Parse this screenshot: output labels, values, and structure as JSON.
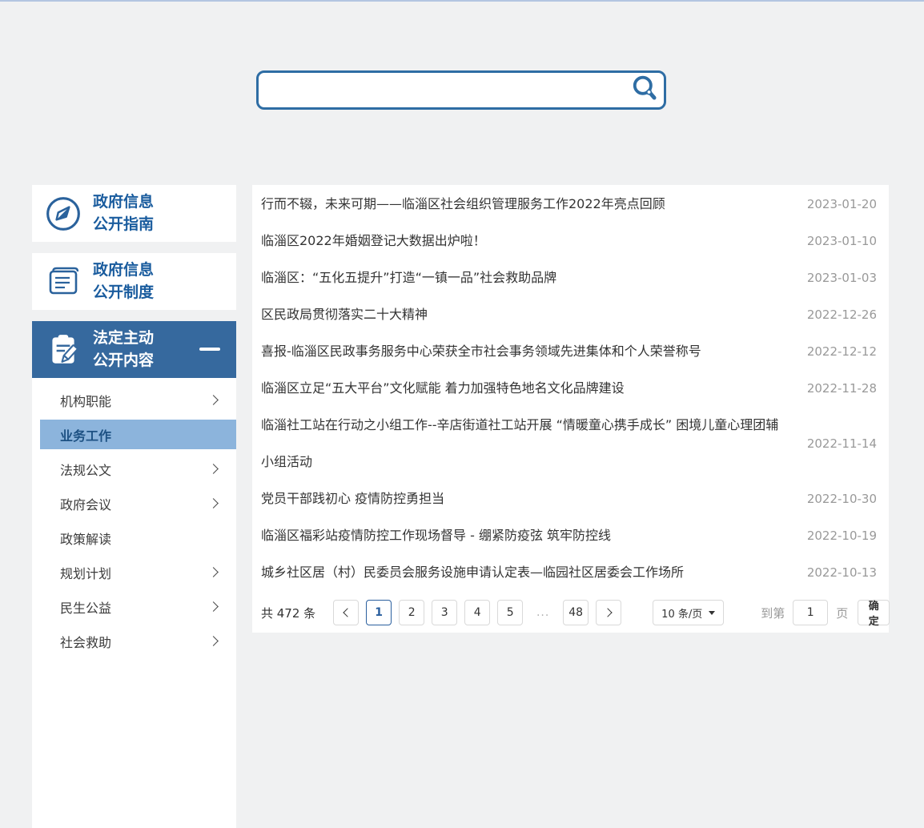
{
  "search": {
    "value": "",
    "placeholder": ""
  },
  "sidebar": {
    "guide": {
      "line1": "政府信息",
      "line2": "公开指南"
    },
    "system": {
      "line1": "政府信息",
      "line2": "公开制度"
    },
    "legal": {
      "line1": "法定主动",
      "line2": "公开内容"
    },
    "menu": [
      {
        "label": "机构职能"
      },
      {
        "label": "业务工作"
      },
      {
        "label": "法规公文"
      },
      {
        "label": "政府会议"
      },
      {
        "label": "政策解读"
      },
      {
        "label": "规划计划"
      },
      {
        "label": "民生公益"
      },
      {
        "label": "社会救助"
      }
    ]
  },
  "articles": [
    {
      "title": "行而不辍，未来可期——临淄区社会组织管理服务工作2022年亮点回顾",
      "date": "2023-01-20"
    },
    {
      "title": "临淄区2022年婚姻登记大数据出炉啦！",
      "date": "2023-01-10"
    },
    {
      "title": "临淄区：“五化五提升”打造“一镇一品”社会救助品牌",
      "date": "2023-01-03"
    },
    {
      "title": "区民政局贯彻落实二十大精神",
      "date": "2022-12-26"
    },
    {
      "title": "喜报-临淄区民政事务服务中心荣获全市社会事务领域先进集体和个人荣誉称号",
      "date": "2022-12-12"
    },
    {
      "title": "临淄区立足“五大平台”文化赋能 着力加强特色地名文化品牌建设",
      "date": "2022-11-28"
    },
    {
      "title": "临淄社工站在行动之小组工作--辛店街道社工站开展 “情暖童心携手成长” 困境儿童心理团辅小组活动",
      "date": "2022-11-14"
    },
    {
      "title": "党员干部践初心 疫情防控勇担当",
      "date": "2022-10-30"
    },
    {
      "title": "临淄区福彩站疫情防控工作现场督导 - 绷紧防疫弦 筑牢防控线",
      "date": "2022-10-19"
    },
    {
      "title": "城乡社区居（村）民委员会服务设施申请认定表—临园社区居委会工作场所",
      "date": "2022-10-13"
    }
  ],
  "pagination": {
    "total": "共 472 条",
    "pages": [
      "1",
      "2",
      "3",
      "4",
      "5",
      "...",
      "48"
    ],
    "active_page": "1",
    "page_size": "10 条/页",
    "goto_label": "到第",
    "goto_value": "1",
    "goto_unit": "页",
    "confirm": "确定"
  },
  "colors": {
    "accent_blue": "#2e6da4",
    "header_bg": "#36699e",
    "active_item_bg": "#8cb4dc",
    "link_blue": "#1a5c9e",
    "date_gray": "#999999",
    "page_bg": "#f0f1f2"
  }
}
